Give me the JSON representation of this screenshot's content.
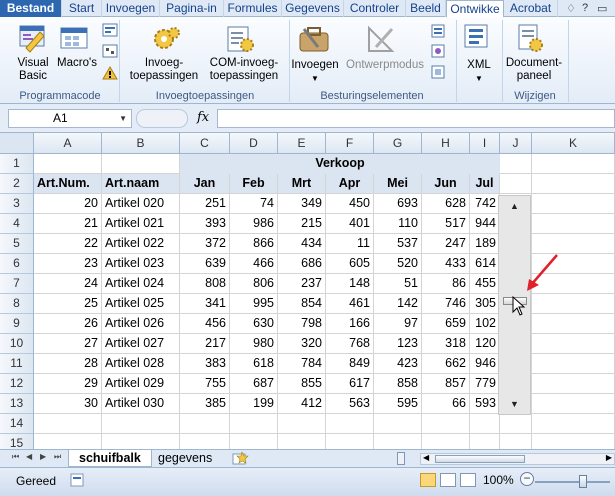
{
  "ribbon": {
    "tabs": [
      "Bestand",
      "Start",
      "Invoegen",
      "Pagina-in",
      "Formules",
      "Gegevens",
      "Controler",
      "Beeld",
      "Ontwikke",
      "Acrobat"
    ],
    "buttons": {
      "visual_basic": [
        "Visual",
        "Basic"
      ],
      "macros": "Macro's",
      "invoeg": [
        "Invoeg-",
        "toepassingen"
      ],
      "com": [
        "COM-invoeg-",
        "toepassingen"
      ],
      "invoegen": "Invoegen",
      "ontwerpmodus": "Ontwerpmodus",
      "xml": "XML",
      "document": [
        "Document-",
        "paneel"
      ]
    },
    "groups": [
      "Programmacode",
      "Invoegtoepassingen",
      "Besturingselementen",
      "Wijzigen"
    ]
  },
  "formula_bar": {
    "name_box": "A1",
    "fx": "fx",
    "content": ""
  },
  "columns": [
    "A",
    "B",
    "C",
    "D",
    "E",
    "F",
    "G",
    "H",
    "I",
    "J",
    "K"
  ],
  "rows": [
    "1",
    "2",
    "3",
    "4",
    "5",
    "6",
    "7",
    "8",
    "9",
    "10",
    "11",
    "12",
    "13",
    "14",
    "15"
  ],
  "table": {
    "group_title": "Verkoop",
    "headers": [
      "Art.Num.",
      "Art.naam",
      "Jan",
      "Feb",
      "Mrt",
      "Apr",
      "Mei",
      "Jun",
      "Jul"
    ],
    "data": [
      [
        "20",
        "Artikel 020",
        "251",
        "74",
        "349",
        "450",
        "693",
        "628",
        "742"
      ],
      [
        "21",
        "Artikel 021",
        "393",
        "986",
        "215",
        "401",
        "110",
        "517",
        "944"
      ],
      [
        "22",
        "Artikel 022",
        "372",
        "866",
        "434",
        "11",
        "537",
        "247",
        "189"
      ],
      [
        "23",
        "Artikel 023",
        "639",
        "466",
        "686",
        "605",
        "520",
        "433",
        "614"
      ],
      [
        "24",
        "Artikel 024",
        "808",
        "806",
        "237",
        "148",
        "51",
        "86",
        "455"
      ],
      [
        "25",
        "Artikel 025",
        "341",
        "995",
        "854",
        "461",
        "142",
        "746",
        "305"
      ],
      [
        "26",
        "Artikel 026",
        "456",
        "630",
        "798",
        "166",
        "97",
        "659",
        "102"
      ],
      [
        "27",
        "Artikel 027",
        "217",
        "980",
        "320",
        "768",
        "123",
        "318",
        "120"
      ],
      [
        "28",
        "Artikel 028",
        "383",
        "618",
        "784",
        "849",
        "423",
        "662",
        "946"
      ],
      [
        "29",
        "Artikel 029",
        "755",
        "687",
        "855",
        "617",
        "858",
        "857",
        "779"
      ],
      [
        "30",
        "Artikel 030",
        "385",
        "199",
        "412",
        "563",
        "595",
        "66",
        "593"
      ]
    ]
  },
  "sheets": [
    "schuifbalk",
    "gegevens"
  ],
  "status": {
    "ready": "Gereed",
    "zoom": "100%"
  },
  "colors": {
    "accent": "#2d67b0",
    "header_fill": "#dbe5f1",
    "arrow": "#e0202a"
  }
}
